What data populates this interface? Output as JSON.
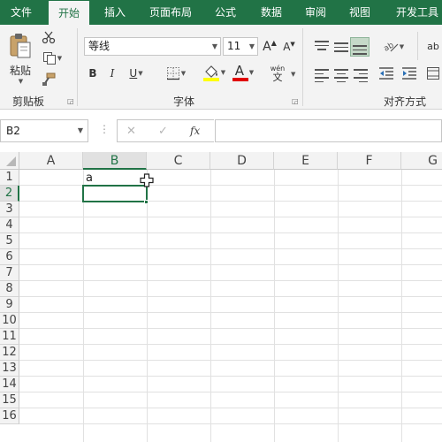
{
  "tabs": [
    {
      "label": "文件",
      "active": false
    },
    {
      "label": "开始",
      "active": true
    },
    {
      "label": "插入",
      "active": false
    },
    {
      "label": "页面布局",
      "active": false
    },
    {
      "label": "公式",
      "active": false
    },
    {
      "label": "数据",
      "active": false
    },
    {
      "label": "审阅",
      "active": false
    },
    {
      "label": "视图",
      "active": false
    },
    {
      "label": "开发工具",
      "active": false
    }
  ],
  "ribbon": {
    "clipboard": {
      "paste_label": "粘贴",
      "group_label": "剪贴板"
    },
    "font": {
      "font_name": "等线",
      "font_size": "11",
      "grow_label": "A",
      "shrink_label": "A",
      "bold_label": "B",
      "italic_label": "I",
      "underline_label": "U",
      "font_color_label": "A",
      "phonetic_top": "wén",
      "phonetic_bottom": "文",
      "group_label": "字体"
    },
    "alignment": {
      "group_label": "对齐方式",
      "wrap_label": "ab"
    }
  },
  "formula_bar": {
    "name_box": "B2",
    "cancel_symbol": "✕",
    "enter_symbol": "✓",
    "fx_label": "fx",
    "formula": ""
  },
  "grid": {
    "columns": [
      "A",
      "B",
      "C",
      "D",
      "E",
      "F",
      "G"
    ],
    "selected_column": "B",
    "rows": [
      "1",
      "2",
      "3",
      "4",
      "5",
      "6",
      "7",
      "8",
      "9",
      "10",
      "11",
      "12",
      "13",
      "14",
      "15",
      "16"
    ],
    "selected_row": "2",
    "cells": {
      "B1": "a"
    },
    "active_cell": "B2"
  },
  "colors": {
    "accent": "#217346",
    "ribbon_bg": "#f3f3f3",
    "fill_color_bar": "#ffff00",
    "font_color_bar": "#e00000"
  }
}
